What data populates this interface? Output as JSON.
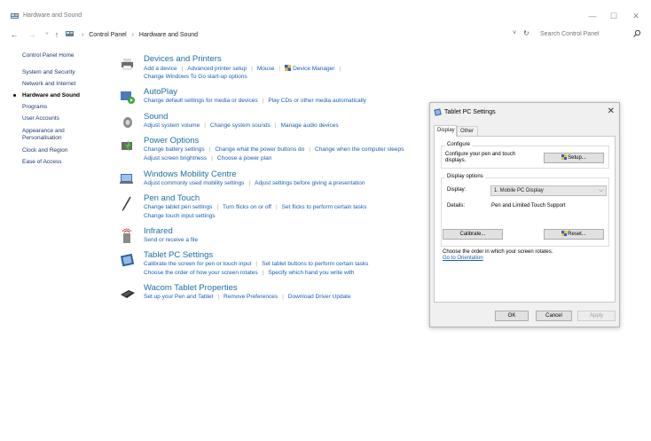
{
  "window": {
    "title": "Hardware and Sound",
    "minimize": "—",
    "maximize": "☐",
    "close": "✕"
  },
  "address": {
    "back": "←",
    "forward": "→",
    "recent": "˅",
    "up": "↑",
    "crumbs": [
      "Control Panel",
      "Hardware and Sound"
    ],
    "separator": "›",
    "dropdown": "˅",
    "refresh": "↻",
    "search_placeholder": "Search Control Panel"
  },
  "sidebar": {
    "items": [
      {
        "label": "Control Panel Home"
      },
      {
        "label": "System and Security"
      },
      {
        "label": "Network and Internet"
      },
      {
        "label": "Hardware and Sound"
      },
      {
        "label": "Programs"
      },
      {
        "label": "User Accounts"
      },
      {
        "label": "Appearance and"
      },
      {
        "label": "Personalisation"
      },
      {
        "label": "Clock and Region"
      },
      {
        "label": "Ease of Access"
      }
    ]
  },
  "categories": [
    {
      "title": "Devices and Printers",
      "icon": "printer-icon",
      "lines": [
        [
          "Add a device",
          "Advanced printer setup",
          "Mouse",
          "Device Manager"
        ],
        [
          "Change Windows To Go start-up options"
        ]
      ]
    },
    {
      "title": "AutoPlay",
      "icon": "autoplay-icon",
      "lines": [
        [
          "Change default settings for media or devices",
          "Play CDs or other media automatically"
        ]
      ]
    },
    {
      "title": "Sound",
      "icon": "speaker-icon",
      "lines": [
        [
          "Adjust system volume",
          "Change system sounds",
          "Manage audio devices"
        ]
      ]
    },
    {
      "title": "Power Options",
      "icon": "power-icon",
      "lines": [
        [
          "Change battery settings",
          "Change what the power buttons do",
          "Change when the computer sleeps"
        ],
        [
          "Adjust screen brightness",
          "Choose a power plan"
        ]
      ]
    },
    {
      "title": "Windows Mobility Centre",
      "icon": "mobility-icon",
      "lines": [
        [
          "Adjust commonly used mobility settings",
          "Adjust settings before giving a presentation"
        ]
      ]
    },
    {
      "title": "Pen and Touch",
      "icon": "pen-icon",
      "lines": [
        [
          "Change tablet pen settings",
          "Turn flicks on or off",
          "Set flicks to perform certain tasks"
        ],
        [
          "Change touch input settings"
        ]
      ]
    },
    {
      "title": "Infrared",
      "icon": "infrared-icon",
      "lines": [
        [
          "Send or receive a file"
        ]
      ]
    },
    {
      "title": "Tablet PC Settings",
      "icon": "tablet-icon",
      "lines": [
        [
          "Calibrate the screen for pen or touch input",
          "Set tablet buttons to perform certain tasks"
        ],
        [
          "Choose the order of how your screen rotates",
          "Specify which hand you write with"
        ]
      ]
    },
    {
      "title": "Wacom Tablet Properties",
      "icon": "wacom-icon",
      "lines": [
        [
          "Set up your Pen and Tablet",
          "Remove Preferences",
          "Download Driver Update"
        ]
      ]
    }
  ],
  "dialog": {
    "title": "Tablet PC Settings",
    "close": "✕",
    "tabs": [
      "Display",
      "Other"
    ],
    "configure_label": "Configure",
    "configure_text_1": "Configure your pen and touch",
    "configure_text_2": "displays.",
    "setup_button": "Setup...",
    "display_options_label": "Display options",
    "display_label": "Display:",
    "display_value": "1. Mobile PC Display",
    "details_label": "Details:",
    "details_value": "Pen and Limited Touch Support",
    "calibrate_button": "Calibrate...",
    "reset_button": "Reset...",
    "rotate_text": "Choose the order in which your screen rotates.",
    "orientation_link": "Go to Orientation",
    "ok_button": "OK",
    "cancel_button": "Cancel",
    "apply_button": "Apply"
  },
  "colors": {
    "link": "#1a5fb4",
    "category_title": "#1d6fa4",
    "dialog_bg": "#f0f0f0"
  }
}
